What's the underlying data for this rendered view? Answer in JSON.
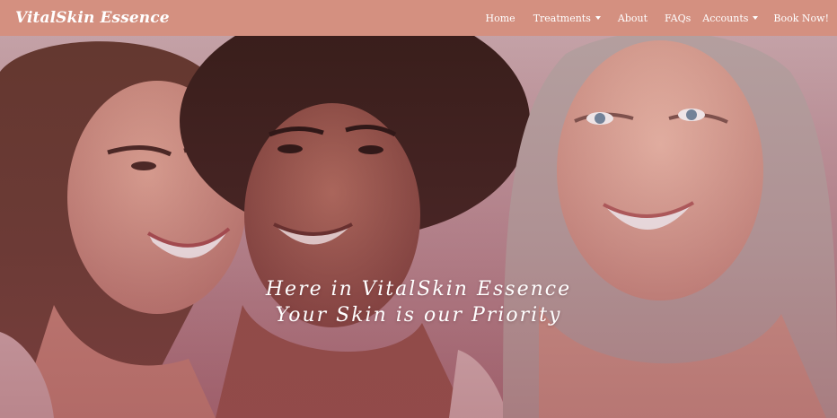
{
  "navbar": {
    "brand": "VitalSkin Essence",
    "bg_color": "#d49080",
    "links": [
      {
        "label": "Home",
        "dropdown": false
      },
      {
        "label": "Treatments",
        "dropdown": true
      },
      {
        "label": "About",
        "dropdown": false
      },
      {
        "label": "FAQs",
        "dropdown": false
      },
      {
        "label": "Accounts",
        "dropdown": true
      },
      {
        "label": "Book Now!",
        "dropdown": false
      }
    ]
  },
  "hero": {
    "line1": "Here in VitalSkin Essence",
    "line2": "Your Skin is our Priority",
    "tint_color": "#a8667a"
  }
}
